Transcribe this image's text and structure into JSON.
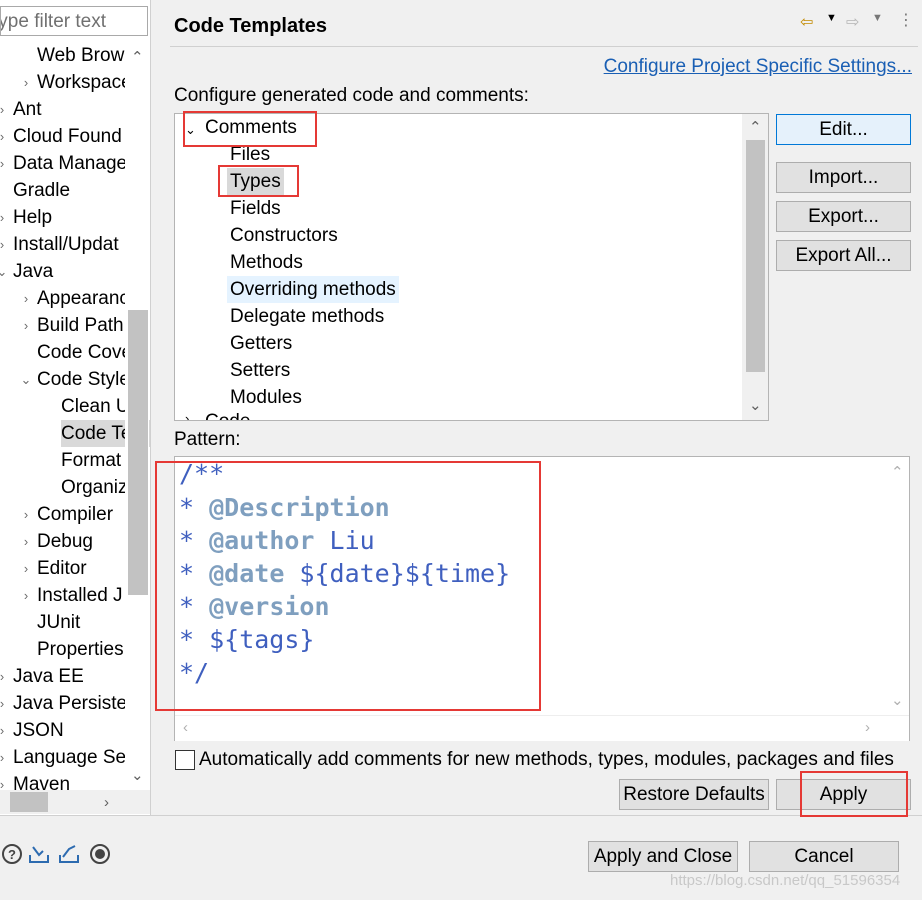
{
  "filter": {
    "placeholder": "type filter text"
  },
  "tree": {
    "items": [
      {
        "label": "Web Brow",
        "twisty": ""
      },
      {
        "label": "Workspace",
        "twisty": "›"
      },
      {
        "label": "Ant",
        "twisty": "›"
      },
      {
        "label": "Cloud Found",
        "twisty": "›"
      },
      {
        "label": "Data Manage",
        "twisty": "›"
      },
      {
        "label": "Gradle",
        "twisty": ""
      },
      {
        "label": "Help",
        "twisty": "›"
      },
      {
        "label": "Install/Updat",
        "twisty": "›"
      },
      {
        "label": "Java",
        "twisty": "⌄"
      },
      {
        "label": "Appearanc",
        "twisty": "›"
      },
      {
        "label": "Build Path",
        "twisty": "›"
      },
      {
        "label": "Code Cove",
        "twisty": ""
      },
      {
        "label": "Code Style",
        "twisty": "⌄"
      },
      {
        "label": "Clean U",
        "twisty": ""
      },
      {
        "label": "Code Te",
        "twisty": ""
      },
      {
        "label": "Format",
        "twisty": ""
      },
      {
        "label": "Organiz",
        "twisty": ""
      },
      {
        "label": "Compiler",
        "twisty": "›"
      },
      {
        "label": "Debug",
        "twisty": "›"
      },
      {
        "label": "Editor",
        "twisty": "›"
      },
      {
        "label": "Installed J",
        "twisty": "›"
      },
      {
        "label": "JUnit",
        "twisty": ""
      },
      {
        "label": "Properties",
        "twisty": ""
      },
      {
        "label": "Java EE",
        "twisty": "›"
      },
      {
        "label": "Java Persisten",
        "twisty": "›"
      },
      {
        "label": "JSON",
        "twisty": "›"
      },
      {
        "label": "Language Se",
        "twisty": "›"
      },
      {
        "label": "Maven",
        "twisty": "›"
      }
    ]
  },
  "header": {
    "title": "Code Templates",
    "link": "Configure Project Specific Settings..."
  },
  "configure_label": "Configure generated code and comments:",
  "templates": {
    "group": "Comments",
    "children": [
      "Files",
      "Types",
      "Fields",
      "Constructors",
      "Methods",
      "Overriding methods",
      "Delegate methods",
      "Getters",
      "Setters",
      "Modules"
    ],
    "next_group_partial": "Code"
  },
  "buttons": {
    "edit": "Edit...",
    "import": "Import...",
    "export": "Export...",
    "export_all": "Export All...",
    "restore": "Restore Defaults",
    "apply": "Apply",
    "apply_close": "Apply and Close",
    "cancel": "Cancel"
  },
  "pattern_label": "Pattern:",
  "pattern": {
    "line1": "/**",
    "line2_star": "* ",
    "line2_tag": "@Description",
    "line3_star": "* ",
    "line3_tag": "@author",
    "line3_rest": " Liu",
    "line4_star": "* ",
    "line4_tag": "@date",
    "line4_rest": " ${date}${time}",
    "line5_star": "* ",
    "line5_tag": "@version",
    "line6": "* ${tags}",
    "line7": "*/"
  },
  "auto_comments_label": "Automatically add comments for new methods, types, modules, packages and files",
  "auto_comments_checked": false,
  "watermark": "https://blog.csdn.net/qq_51596354",
  "icons": [
    "help-icon",
    "import-icon",
    "export-icon",
    "record-icon"
  ],
  "colors": {
    "highlight": "#e53935",
    "selected": "#d9d9d9",
    "hover": "#e5f3ff",
    "code": "#3f5fbf",
    "javadoc_tag": "#7f9fbf"
  }
}
